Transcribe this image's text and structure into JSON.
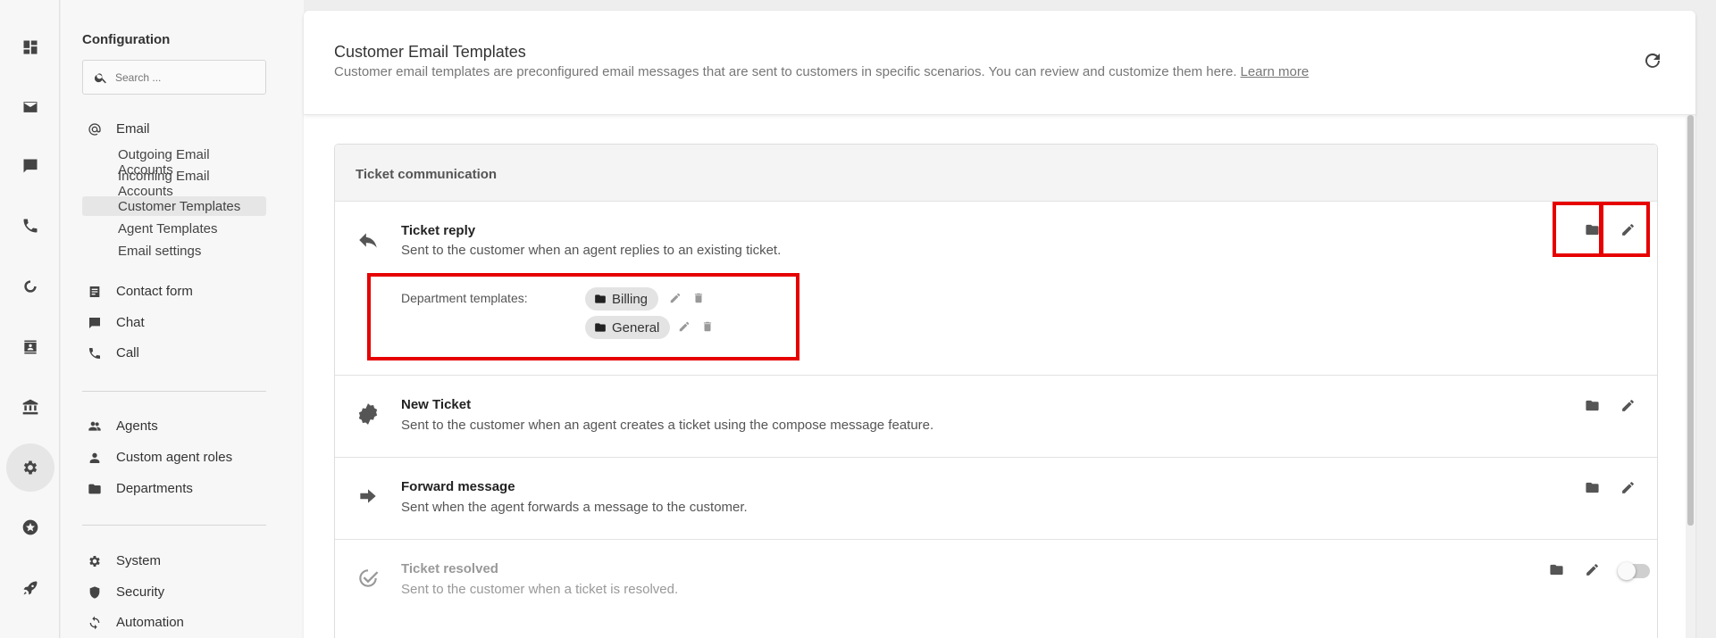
{
  "rail": {
    "items": [
      {
        "icon": "dashboard-icon"
      },
      {
        "icon": "email-icon"
      },
      {
        "icon": "chat-icon"
      },
      {
        "icon": "phone-icon"
      },
      {
        "icon": "loading-icon"
      },
      {
        "icon": "contacts-icon"
      },
      {
        "icon": "bank-icon"
      },
      {
        "icon": "gear-icon",
        "active": true
      },
      {
        "icon": "star-icon"
      },
      {
        "icon": "rocket-icon"
      }
    ]
  },
  "sidebar": {
    "title": "Configuration",
    "search_placeholder": "Search ...",
    "email": {
      "label": "Email",
      "items": [
        {
          "label": "Outgoing Email Accounts"
        },
        {
          "label": "Incoming Email Accounts"
        },
        {
          "label": "Customer Templates",
          "active": true
        },
        {
          "label": "Agent Templates"
        },
        {
          "label": "Email settings"
        }
      ]
    },
    "group1": [
      {
        "label": "Contact form",
        "icon": "form-icon"
      },
      {
        "label": "Chat",
        "icon": "chat-icon"
      },
      {
        "label": "Call",
        "icon": "phone-icon"
      }
    ],
    "group2": [
      {
        "label": "Agents",
        "icon": "agents-icon"
      },
      {
        "label": "Custom agent roles",
        "icon": "person-icon"
      },
      {
        "label": "Departments",
        "icon": "folder-icon"
      }
    ],
    "group3": [
      {
        "label": "System",
        "icon": "gear-icon"
      },
      {
        "label": "Security",
        "icon": "shield-icon"
      },
      {
        "label": "Automation",
        "icon": "automation-icon"
      }
    ]
  },
  "header": {
    "title": "Customer Email Templates",
    "description": "Customer email templates are preconfigured email messages that are sent to customers in specific scenarios. You can review and customize them here.",
    "learn_more": "Learn more"
  },
  "section": {
    "title": "Ticket communication",
    "rows": [
      {
        "title": "Ticket reply",
        "description": "Sent to the customer when an agent replies to an existing ticket.",
        "icon": "reply-icon",
        "department_label": "Department templates:",
        "departments": [
          "Billing",
          "General"
        ]
      },
      {
        "title": "New Ticket",
        "description": "Sent to the customer when an agent creates a ticket using the compose message feature.",
        "icon": "badge-icon"
      },
      {
        "title": "Forward message",
        "description": "Sent when the agent forwards a message to the customer.",
        "icon": "arrow-right-icon"
      },
      {
        "title": "Ticket resolved",
        "description": "Sent to the customer when a ticket is resolved.",
        "icon": "check-circle-icon",
        "enabled": false
      }
    ]
  },
  "colors": {
    "highlight": "#e60000",
    "chip": "#e3e3e3",
    "active_nav": "#e6e6e6"
  }
}
